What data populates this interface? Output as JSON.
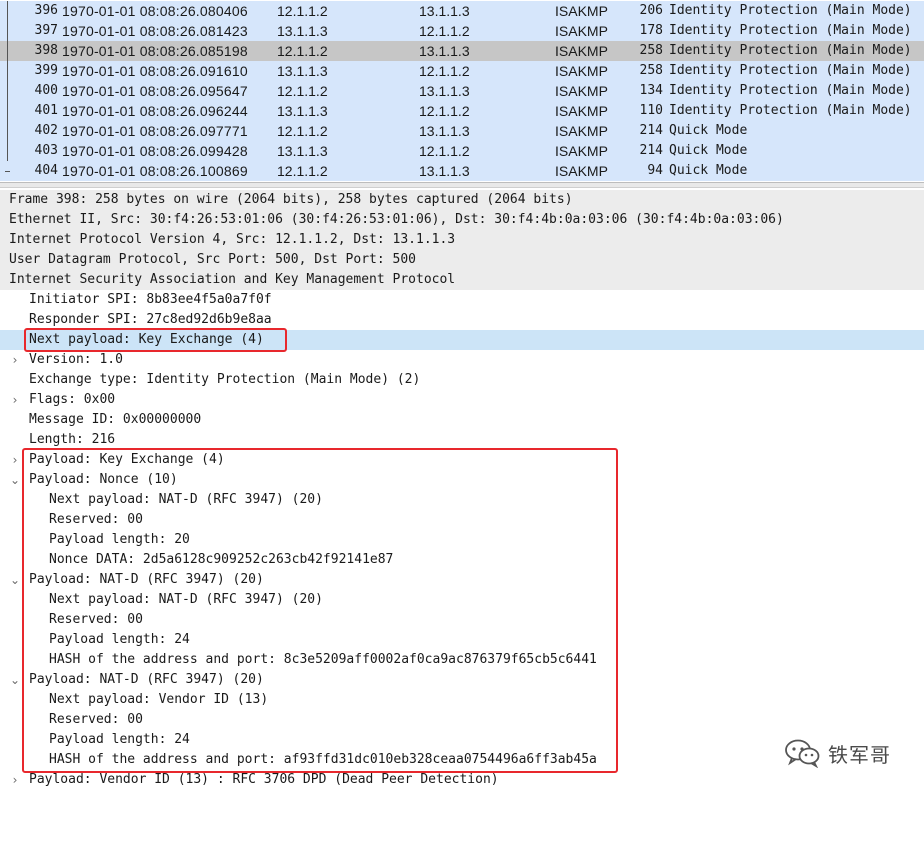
{
  "packet_list": {
    "rows": [
      {
        "no": "396",
        "time": "1970-01-01 08:08:26.080406",
        "src": "12.1.1.2",
        "dst": "13.1.1.3",
        "proto": "ISAKMP",
        "len": "206",
        "info": "Identity Protection (Main Mode)"
      },
      {
        "no": "397",
        "time": "1970-01-01 08:08:26.081423",
        "src": "13.1.1.3",
        "dst": "12.1.1.2",
        "proto": "ISAKMP",
        "len": "178",
        "info": "Identity Protection (Main Mode)"
      },
      {
        "no": "398",
        "time": "1970-01-01 08:08:26.085198",
        "src": "12.1.1.2",
        "dst": "13.1.1.3",
        "proto": "ISAKMP",
        "len": "258",
        "info": "Identity Protection (Main Mode)"
      },
      {
        "no": "399",
        "time": "1970-01-01 08:08:26.091610",
        "src": "13.1.1.3",
        "dst": "12.1.1.2",
        "proto": "ISAKMP",
        "len": "258",
        "info": "Identity Protection (Main Mode)"
      },
      {
        "no": "400",
        "time": "1970-01-01 08:08:26.095647",
        "src": "12.1.1.2",
        "dst": "13.1.1.3",
        "proto": "ISAKMP",
        "len": "134",
        "info": "Identity Protection (Main Mode)"
      },
      {
        "no": "401",
        "time": "1970-01-01 08:08:26.096244",
        "src": "13.1.1.3",
        "dst": "12.1.1.2",
        "proto": "ISAKMP",
        "len": "110",
        "info": "Identity Protection (Main Mode)"
      },
      {
        "no": "402",
        "time": "1970-01-01 08:08:26.097771",
        "src": "12.1.1.2",
        "dst": "13.1.1.3",
        "proto": "ISAKMP",
        "len": "214",
        "info": "Quick Mode"
      },
      {
        "no": "403",
        "time": "1970-01-01 08:08:26.099428",
        "src": "13.1.1.3",
        "dst": "12.1.1.2",
        "proto": "ISAKMP",
        "len": "214",
        "info": "Quick Mode"
      },
      {
        "no": "404",
        "time": "1970-01-01 08:08:26.100869",
        "src": "12.1.1.2",
        "dst": "13.1.1.3",
        "proto": "ISAKMP",
        "len": "94",
        "info": "Quick Mode"
      }
    ],
    "selected_no": "398"
  },
  "details": {
    "frame": "Frame 398: 258 bytes on wire (2064 bits), 258 bytes captured (2064 bits)",
    "ethernet": "Ethernet II, Src: 30:f4:26:53:01:06 (30:f4:26:53:01:06), Dst: 30:f4:4b:0a:03:06 (30:f4:4b:0a:03:06)",
    "ip": "Internet Protocol Version 4, Src: 12.1.1.2, Dst: 13.1.1.3",
    "udp": "User Datagram Protocol, Src Port: 500, Dst Port: 500",
    "isakmp": "Internet Security Association and Key Management Protocol",
    "initiator_spi": "Initiator SPI: 8b83ee4f5a0a7f0f",
    "responder_spi": "Responder SPI: 27c8ed92d6b9e8aa",
    "next_payload": "Next payload: Key Exchange (4)",
    "version": "Version: 1.0",
    "exchange_type": "Exchange type: Identity Protection (Main Mode) (2)",
    "flags": "Flags: 0x00",
    "message_id": "Message ID: 0x00000000",
    "length": "Length: 216",
    "payload_ke": "Payload: Key Exchange (4)",
    "payload_nonce": "Payload: Nonce (10)",
    "nonce_next": "Next payload: NAT-D (RFC 3947) (20)",
    "nonce_reserved": "Reserved: 00",
    "nonce_len": "Payload length: 20",
    "nonce_data": "Nonce DATA: 2d5a6128c909252c263cb42f92141e87",
    "payload_natd1": "Payload: NAT-D (RFC 3947) (20)",
    "natd1_next": "Next payload: NAT-D (RFC 3947) (20)",
    "natd1_reserved": "Reserved: 00",
    "natd1_len": "Payload length: 24",
    "natd1_hash": "HASH of the address and port: 8c3e5209aff0002af0ca9ac876379f65cb5c6441",
    "payload_natd2": "Payload: NAT-D (RFC 3947) (20)",
    "natd2_next": "Next payload: Vendor ID (13)",
    "natd2_reserved": "Reserved: 00",
    "natd2_len": "Payload length: 24",
    "natd2_hash": "HASH of the address and port: af93ffd31dc010eb328ceaa0754496a6ff3ab45a",
    "payload_vendor": "Payload: Vendor ID (13) : RFC 3706 DPD (Dead Peer Detection)"
  },
  "watermark": {
    "text": "铁军哥",
    "icon": "wechat-icon"
  },
  "colors": {
    "row_bg": "#d6e6fb",
    "selected_bg": "#c6c6c6",
    "highlight_bg": "#cce4f7",
    "annotation": "#e8282d"
  }
}
